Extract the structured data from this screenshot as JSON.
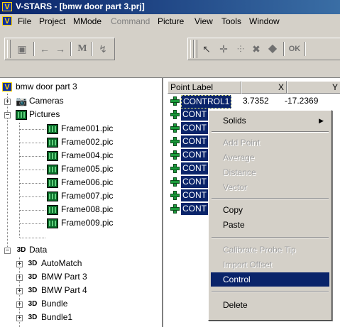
{
  "window": {
    "title": "V-STARS - [bmw door part 3.prj]"
  },
  "menubar": {
    "items": [
      {
        "label": "File",
        "enabled": true
      },
      {
        "label": "Project",
        "enabled": true
      },
      {
        "label": "MMode",
        "enabled": true
      },
      {
        "label": "Command",
        "enabled": false
      },
      {
        "label": "Picture",
        "enabled": true
      },
      {
        "label": "View",
        "enabled": true
      },
      {
        "label": "Tools",
        "enabled": true
      },
      {
        "label": "Window",
        "enabled": true
      }
    ]
  },
  "toolbar": {
    "m_label": "M",
    "ok_label": "OK"
  },
  "tree": {
    "root": "bmw door part 3",
    "cameras": "Cameras",
    "pictures": "Pictures",
    "frames": [
      "Frame001.pic",
      "Frame002.pic",
      "Frame004.pic",
      "Frame005.pic",
      "Frame006.pic",
      "Frame007.pic",
      "Frame008.pic",
      "Frame009.pic"
    ],
    "data": "Data",
    "data_items": [
      "AutoMatch",
      "BMW Part 3",
      "BMW Part 4",
      "Bundle",
      "Bundle1"
    ],
    "icon_3d": "3D"
  },
  "table": {
    "headers": [
      "Point Label",
      "X",
      "Y"
    ],
    "first_row": {
      "label": "CONTROL1",
      "x": "3.7352",
      "y": "-17.2369"
    },
    "truncated_label": "CONT",
    "row_count": 9
  },
  "context_menu": {
    "items": [
      {
        "label": "Solids",
        "enabled": true,
        "submenu": true
      },
      {
        "label": "Add Point",
        "enabled": false
      },
      {
        "label": "Average",
        "enabled": false
      },
      {
        "label": "Distance",
        "enabled": false
      },
      {
        "label": "Vector",
        "enabled": false
      },
      {
        "label": "Copy",
        "enabled": true
      },
      {
        "label": "Paste",
        "enabled": true
      },
      {
        "label": "Calibrate Probe Tip",
        "enabled": false
      },
      {
        "label": "Import Offset",
        "enabled": false
      },
      {
        "label": "Control",
        "enabled": true,
        "selected": true
      },
      {
        "label": "Delete",
        "enabled": true
      }
    ],
    "submenu_arrow": "▶"
  },
  "colors": {
    "title_bar": "#0a246a",
    "selection": "#0a246a",
    "face": "#d4d0c8",
    "point_icon": "#1a9a3a"
  }
}
